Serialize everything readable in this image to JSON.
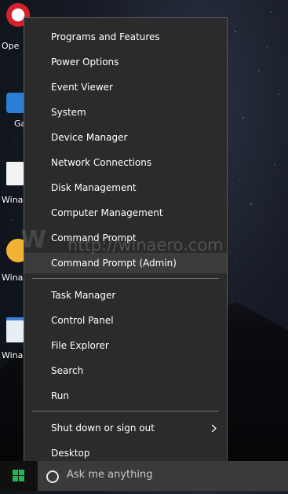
{
  "desktop": {
    "icons": [
      {
        "icon": "opera-icon",
        "label": "Ope"
      },
      {
        "icon": "puzzle-icon",
        "label": "Ga"
      },
      {
        "icon": "winaero-doc-icon",
        "label": "Wina"
      },
      {
        "icon": "winaero-app-icon",
        "label": "Wina"
      },
      {
        "icon": "winaero-window-icon",
        "label": "Wina"
      }
    ]
  },
  "menu": {
    "group1": [
      "Programs and Features",
      "Power Options",
      "Event Viewer",
      "System",
      "Device Manager",
      "Network Connections",
      "Disk Management",
      "Computer Management",
      "Command Prompt",
      "Command Prompt (Admin)"
    ],
    "group2": [
      "Task Manager",
      "Control Panel",
      "File Explorer",
      "Search",
      "Run"
    ],
    "group3": [
      "Shut down or sign out",
      "Desktop"
    ],
    "highlighted": "Command Prompt (Admin)",
    "submenu_item": "Shut down or sign out"
  },
  "watermark": {
    "logo": "W",
    "url": "http://winaero.com"
  },
  "taskbar": {
    "start_icon": "windows-logo-icon",
    "search_icon": "cortana-circle-icon",
    "search_placeholder": "Ask me anything"
  },
  "colors": {
    "menu_bg": "#2b2b2b",
    "highlight_bg": "#3c3c3c",
    "start_green": "#1db954"
  }
}
